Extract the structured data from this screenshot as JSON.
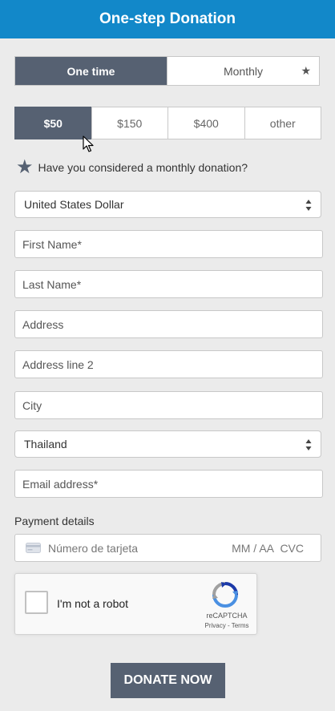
{
  "header": {
    "title": "One-step Donation"
  },
  "frequency": {
    "options": [
      "One time",
      "Monthly"
    ],
    "selected": "One time"
  },
  "amounts": {
    "options": [
      "$50",
      "$150",
      "$400",
      "other"
    ],
    "selected": "$50"
  },
  "monthly_note": {
    "text": "Have you considered a monthly donation?"
  },
  "currency": {
    "value": "United States Dollar"
  },
  "fields": {
    "first_name": "First Name*",
    "last_name": "Last Name*",
    "address": "Address",
    "address2": "Address line 2",
    "city": "City",
    "email": "Email address*"
  },
  "country": {
    "value": "Thailand"
  },
  "payment": {
    "label": "Payment details",
    "card_placeholder": "Número de tarjeta",
    "exp_placeholder": "MM / AA",
    "cvc_placeholder": "CVC"
  },
  "captcha": {
    "label": "I'm not a robot",
    "brand": "reCAPTCHA",
    "links": "Privacy - Terms"
  },
  "donate": {
    "label": "DONATE NOW"
  },
  "colors": {
    "header": "#1288c9",
    "active": "#566172",
    "background": "#ebebeb"
  },
  "icons": [
    "star-icon",
    "select-arrows-icon",
    "card-icon",
    "recaptcha-logo-icon",
    "mouse-cursor-icon"
  ]
}
